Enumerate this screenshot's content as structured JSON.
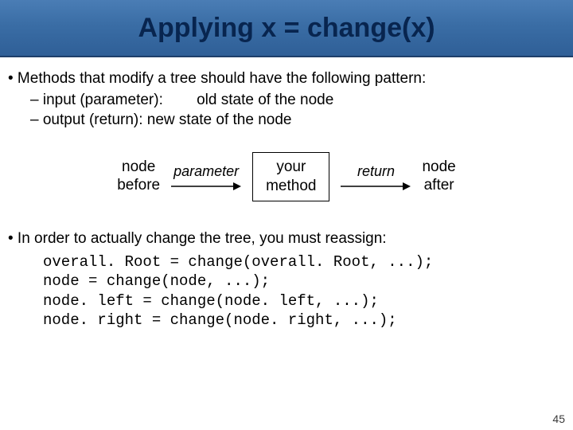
{
  "title": "Applying x = change(x)",
  "bullets": {
    "b1": "• Methods that modify a tree should have the following pattern:",
    "sub1": "– input (parameter):        old state of the node",
    "sub2": "– output (return):  new state of the node",
    "b2": "• In order to actually change the tree, you must reassign:"
  },
  "diagram": {
    "left": "node\nbefore",
    "arrow1": "parameter",
    "box": "your\nmethod",
    "arrow2": "return",
    "right": "node\nafter"
  },
  "code": {
    "l1": "overall. Root = change(overall. Root, ...);",
    "l2": "node = change(node, ...);",
    "l3": "node. left = change(node. left, ...);",
    "l4": "node. right = change(node. right, ...);"
  },
  "slidenum": "45"
}
